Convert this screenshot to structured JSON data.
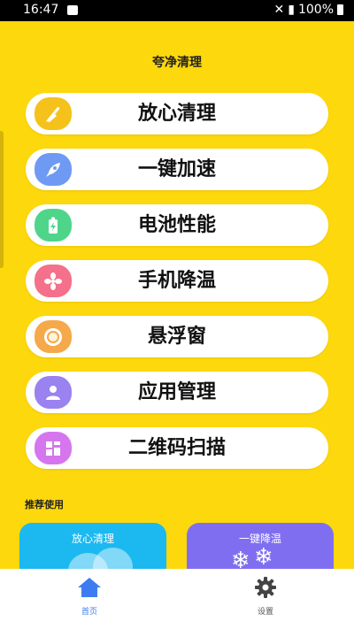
{
  "status_bar": {
    "time": "16:47",
    "battery": "100%"
  },
  "page": {
    "title": "夸净清理"
  },
  "menu": [
    {
      "label": "放心清理",
      "icon": "broom-icon",
      "color": "#f5c21b"
    },
    {
      "label": "一键加速",
      "icon": "rocket-icon",
      "color": "#6f9af3"
    },
    {
      "label": "电池性能",
      "icon": "battery-charging-icon",
      "color": "#4fd58a"
    },
    {
      "label": "手机降温",
      "icon": "fan-icon",
      "color": "#f5708a"
    },
    {
      "label": "悬浮窗",
      "icon": "floating-ball-icon",
      "color": "#f5a94a"
    },
    {
      "label": "应用管理",
      "icon": "user-icon",
      "color": "#9a82f0"
    },
    {
      "label": "二维码扫描",
      "icon": "qr-scan-icon",
      "color": "#d576ef"
    }
  ],
  "recommend": {
    "title": "推荐使用",
    "cards": [
      {
        "label": "放心清理",
        "color": "#1bb9f0"
      },
      {
        "label": "一键降温",
        "color": "#7f6ff0"
      }
    ]
  },
  "tabs": [
    {
      "label": "首页",
      "icon": "home-icon",
      "active": true
    },
    {
      "label": "设置",
      "icon": "gear-icon",
      "active": false
    }
  ]
}
